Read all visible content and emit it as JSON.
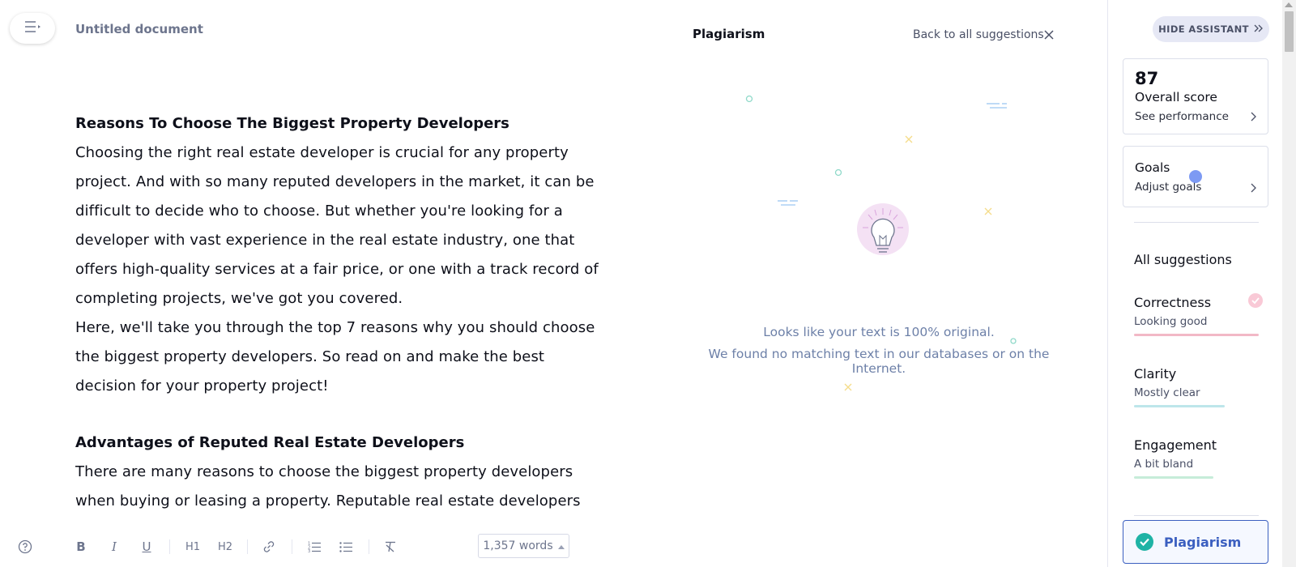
{
  "document": {
    "title": "Untitled document",
    "heading1": "Reasons To Choose The Biggest Property Developers",
    "para1": "Choosing the right real estate developer is crucial for any property project. And with so many reputed developers in the market, it can be difficult to decide who to choose. But whether you're looking for a developer with vast experience in the real estate industry, one that offers high-quality services at a fair price, or one with a track record of completing projects, we've got you covered.",
    "para2": "Here, we'll take you through the top 7 reasons why you should choose the biggest property developers. So read on and make the best decision for your property project!",
    "heading2": "Advantages of Reputed Real Estate Developers",
    "para3": "There are many reasons to choose the biggest property developers when buying or leasing a property. Reputable real estate developers"
  },
  "toolbar": {
    "buttons": [
      "help-icon",
      "bold-icon",
      "italic-icon",
      "underline-icon",
      "h1-icon",
      "h2-icon",
      "link-icon",
      "numbered-list-icon",
      "bullet-list-icon",
      "clear-format-icon"
    ],
    "bold": "B",
    "italic": "I",
    "underline": "U",
    "h1": "H1",
    "h2": "H2",
    "word_count": "1,357 words"
  },
  "plagiarism": {
    "title": "Plagiarism",
    "back_label": "Back to all suggestions",
    "message_line1": "Looks like your text is 100% original.",
    "message_line2": "We found no matching text in our databases or on the Internet."
  },
  "sidebar": {
    "hide_label": "HIDE ASSISTANT",
    "score": "87",
    "score_label": "Overall score",
    "performance_label": "See performance",
    "goals_label": "Goals",
    "adjust_goals_label": "Adjust goals",
    "all_suggestions_label": "All suggestions",
    "categories": [
      {
        "name": "Correctness",
        "status": "Looking good",
        "color": "#f2b8c6"
      },
      {
        "name": "Clarity",
        "status": "Mostly clear",
        "color": "#bde6ea"
      },
      {
        "name": "Engagement",
        "status": "A bit bland",
        "color": "#c6ecd9"
      }
    ],
    "plagiarism_label": "Plagiarism"
  },
  "colors": {
    "accent": "#3b5fc0",
    "check": "#15c39a"
  }
}
